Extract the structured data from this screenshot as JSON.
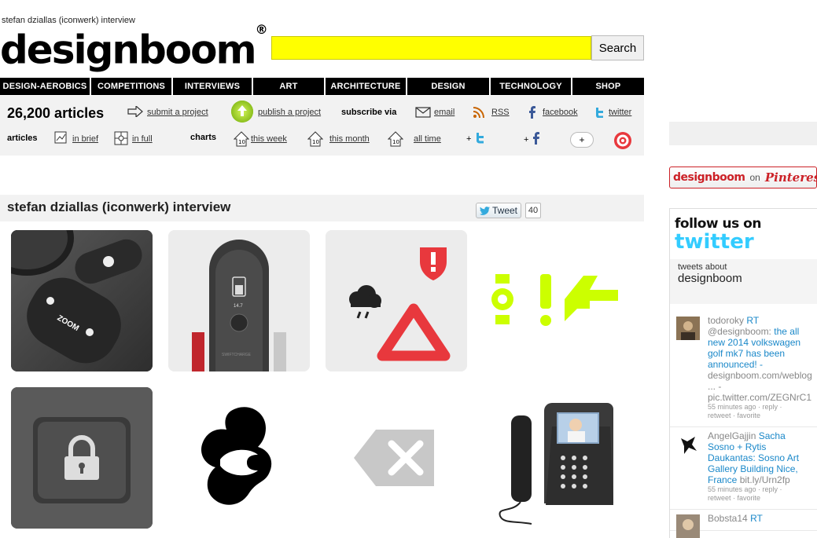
{
  "page": {
    "small_title": "stefan dziallas (iconwerk) interview"
  },
  "logo": {
    "text": "designboom",
    "mark": "®"
  },
  "search": {
    "value": "",
    "button_label": "Search",
    "field_color": "#ffff00"
  },
  "nav": [
    {
      "label": "DESIGN-AEROBICS"
    },
    {
      "label": "COMPETITIONS"
    },
    {
      "label": "INTERVIEWS"
    },
    {
      "label": "ART"
    },
    {
      "label": "ARCHITECTURE"
    },
    {
      "label": "DESIGN"
    },
    {
      "label": "TECHNOLOGY"
    },
    {
      "label": "SHOP"
    }
  ],
  "infobar": {
    "count": "26,200 articles",
    "submit": "submit a project",
    "publish": "publish a project",
    "subscribe_label": "subscribe via",
    "email": "email",
    "rss": "RSS",
    "facebook": "facebook",
    "twitter": "twitter",
    "articles_label": "articles",
    "in_brief": "in brief",
    "in_full": "in full",
    "charts_label": "charts",
    "this_week": "this week",
    "this_month": "this month",
    "all_time": "all time",
    "plus_twitter": "+",
    "plus_facebook": "+",
    "plus_one": "+"
  },
  "pinterest": {
    "brand": "designboom",
    "on": "on",
    "service": "Pinterest"
  },
  "twitter_widget": {
    "follow": "follow us on",
    "word": "twitter",
    "about_label": "tweets about",
    "about_value": "designboom",
    "tweets": [
      {
        "user": "todoroky",
        "rt": "RT",
        "text_a": "@designboom:",
        "text_b": "the all new 2014 volkswagen golf mk7 has been announced! -",
        "link1": "designboom.com/weblog",
        "text_c": "... -",
        "link2": "pic.twitter.com/ZEGNrC1",
        "meta1": "55 minutes ago · reply ·",
        "meta2": "retweet · favorite"
      },
      {
        "user": "AngelGajjin",
        "rt": "Sacha Sosno + Rytis Daukantas: Sosno Art Gallery Building Nice, France",
        "text_a": "bit.ly/Urn2fp",
        "meta1": "55 minutes ago · reply ·",
        "meta2": "retweet · favorite"
      },
      {
        "user": "Bobsta14",
        "rt": "RT"
      }
    ]
  },
  "article": {
    "title": "stefan dziallas (iconwerk) interview",
    "tweet_label": "Tweet",
    "tweet_count": "40"
  },
  "tiles": {
    "zoom_label": "ZOOM",
    "battery_label": "14.7",
    "brand_label": "SWIFTCHARGE"
  },
  "colors": {
    "accent_lime": "#ccff00",
    "warning_red": "#e8383d",
    "twitter_blue": "#33ccff",
    "pinterest_red": "#cc2127"
  }
}
